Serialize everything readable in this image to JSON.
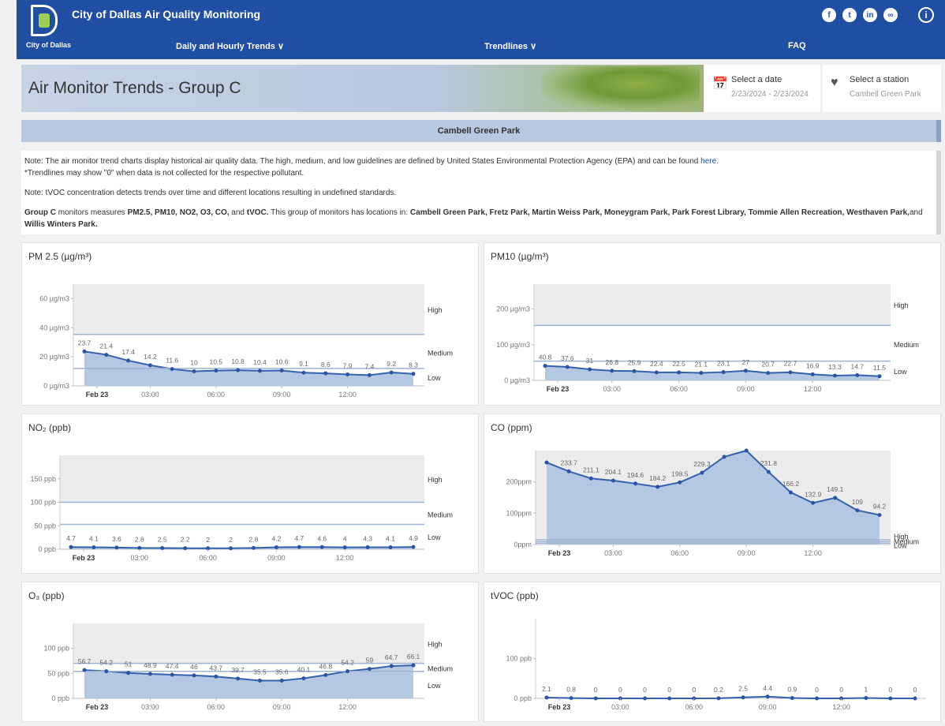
{
  "header": {
    "app_title": "City of Dallas Air Quality Monitoring",
    "logo_text": "City of Dallas",
    "nav": [
      "Daily and Hourly Trends ∨",
      "Trendlines ∨",
      "FAQ"
    ],
    "social": [
      "f",
      "t",
      "in",
      "∞"
    ],
    "info": "i"
  },
  "page_title": "Air Monitor Trends - Group C",
  "date_selector": {
    "label": "Select a date",
    "value": "2/23/2024 - 2/23/2024"
  },
  "station_selector": {
    "label": "Select a station",
    "value": "Cambell Green Park"
  },
  "station_name": "Cambell Green Park",
  "notes": {
    "line1": "Note: The air monitor trend charts display historical air quality data. The high, medium, and low guidelines are defined by United States Environmental Protection Agency (EPA) and can be found",
    "link": "here.",
    "line2": "*Trendlines may show \"0\" when data is not collected for the respective pollutant.",
    "line3": "Note: tVOC concentration detects trends over time and different locations resulting in undefined standards.",
    "group": "Group C",
    "measures_text": " monitors measures ",
    "pollutants": "PM2.5, PM10, NO2, O3, CO,",
    "and_text": " and ",
    "tvoc": "tVOC.",
    "locations_text": " This group of monitors has locations in: ",
    "locations": "Cambell Green Park, Fretz Park, Martin Weiss Park, Moneygram Park, Park Forest Library, Tommie Allen Recreation, Westhaven Park,",
    "and2": "and",
    "last_location": " Willis Winters Park."
  },
  "chart_data": [
    {
      "id": "pm25",
      "type": "area",
      "title": "PM 2.5 (µg/m³)",
      "x": [
        "00:30",
        "01:30",
        "02:30",
        "03:30",
        "04:30",
        "05:30",
        "06:30",
        "07:30",
        "08:30",
        "09:30",
        "10:30",
        "11:30",
        "12:30",
        "13:30",
        "14:30",
        "15:30"
      ],
      "x_ticks": [
        "Feb 23",
        "03:00",
        "06:00",
        "09:00",
        "12:00"
      ],
      "values": [
        23.7,
        21.4,
        17.4,
        14.2,
        11.6,
        10,
        10.5,
        10.8,
        10.4,
        10.6,
        9.1,
        8.6,
        7.9,
        7.4,
        9.2,
        8.3
      ],
      "ylim": [
        0,
        70
      ],
      "y_ticks": [
        0,
        20,
        40,
        60
      ],
      "y_tick_labels": [
        "0 µg/m3",
        "20 µg/m3",
        "40 µg/m3",
        "60 µg/m3"
      ],
      "thresholds": [
        {
          "name": "Low",
          "value": 12
        },
        {
          "name": "Medium",
          "value": 35.4
        }
      ],
      "band_labels": [
        "High",
        "Medium",
        "Low"
      ]
    },
    {
      "id": "pm10",
      "type": "area",
      "title": "PM10 (µg/m³)",
      "x": [
        "00:30",
        "01:30",
        "02:30",
        "03:30",
        "04:30",
        "05:30",
        "06:30",
        "07:30",
        "08:30",
        "09:30",
        "10:30",
        "11:30",
        "12:30",
        "13:30",
        "14:30",
        "15:30"
      ],
      "x_ticks": [
        "Feb 23",
        "03:00",
        "06:00",
        "09:00",
        "12:00"
      ],
      "values": [
        40.8,
        37.6,
        31,
        26.8,
        25.9,
        22.4,
        22.5,
        21.1,
        23.1,
        27,
        20.7,
        22.7,
        16.9,
        13.3,
        14.7,
        11.5
      ],
      "ylim": [
        0,
        270
      ],
      "y_ticks": [
        0,
        100,
        200
      ],
      "y_tick_labels": [
        "0 µg/m3",
        "100 µg/m3",
        "200 µg/m3"
      ],
      "thresholds": [
        {
          "name": "Low",
          "value": 54
        },
        {
          "name": "Medium",
          "value": 154
        }
      ],
      "band_labels": [
        "High",
        "Medium",
        "Low"
      ]
    },
    {
      "id": "no2",
      "type": "area",
      "title": "NO₂ (ppb)",
      "x": [
        "00:30",
        "01:30",
        "02:30",
        "03:30",
        "04:30",
        "05:30",
        "06:30",
        "07:30",
        "08:30",
        "09:30",
        "10:30",
        "11:30",
        "12:30",
        "13:30",
        "14:30",
        "15:30"
      ],
      "x_ticks": [
        "Feb 23",
        "03:00",
        "06:00",
        "09:00",
        "12:00"
      ],
      "values": [
        4.7,
        4.1,
        3.6,
        2.8,
        2.5,
        2.2,
        2,
        2,
        2.8,
        4.2,
        4.7,
        4.6,
        4,
        4.3,
        4.1,
        4.9
      ],
      "ylim": [
        0,
        200
      ],
      "y_ticks": [
        0,
        50,
        100,
        150
      ],
      "y_tick_labels": [
        "0 ppb",
        "50 ppb",
        "100 ppb",
        "150 ppb"
      ],
      "thresholds": [
        {
          "name": "Low",
          "value": 53
        },
        {
          "name": "Medium",
          "value": 100
        }
      ],
      "band_labels": [
        "High",
        "Medium",
        "Low"
      ]
    },
    {
      "id": "co",
      "type": "area",
      "title": "CO (ppm)",
      "x": [
        "00:30",
        "01:30",
        "02:30",
        "03:30",
        "04:30",
        "05:30",
        "06:30",
        "07:30",
        "08:30",
        "09:30",
        "10:30",
        "11:30",
        "12:30",
        "13:30",
        "14:30"
      ],
      "x_ticks": [
        "Feb 23",
        "03:00",
        "06:00",
        "09:00",
        "12:00"
      ],
      "values": [
        262,
        233.7,
        211.1,
        204.1,
        194.6,
        184.2,
        198.5,
        229.3,
        280,
        300,
        231.8,
        166.2,
        132.9,
        149.1,
        109,
        94.2
      ],
      "labels": [
        "",
        "233.7",
        "211.1",
        "204.1",
        "194.6",
        "184.2",
        "198.5",
        "229.3",
        "",
        "",
        "231.8",
        "166.2",
        "132.9",
        "149.1",
        "109",
        "94.2"
      ],
      "ylim": [
        0,
        300
      ],
      "y_ticks": [
        0,
        100,
        200
      ],
      "y_tick_labels": [
        "0ppm",
        "100ppm",
        "200ppm"
      ],
      "thresholds": [
        {
          "name": "Low",
          "value": 4.4
        },
        {
          "name": "Medium",
          "value": 9.4
        },
        {
          "name": "High",
          "value": 15
        }
      ],
      "band_labels": [
        "High",
        "Medium",
        "Low"
      ]
    },
    {
      "id": "o3",
      "type": "area",
      "title": "O₃ (ppb)",
      "x": [
        "00:30",
        "01:30",
        "02:30",
        "03:30",
        "04:30",
        "05:30",
        "06:30",
        "07:30",
        "08:30",
        "09:30",
        "10:30",
        "11:30",
        "12:30",
        "13:30",
        "14:30",
        "15:30"
      ],
      "x_ticks": [
        "Feb 23",
        "03:00",
        "06:00",
        "09:00",
        "12:00"
      ],
      "values": [
        56.7,
        54.2,
        51,
        48.9,
        47.4,
        46,
        43.7,
        39.7,
        35.5,
        35.6,
        40.1,
        46.8,
        54.2,
        59,
        64.7,
        66.1
      ],
      "ylim": [
        0,
        150
      ],
      "y_ticks": [
        0,
        50,
        100
      ],
      "y_tick_labels": [
        "0 ppb",
        "50 ppb",
        "100 ppb"
      ],
      "thresholds": [
        {
          "name": "Low",
          "value": 54
        },
        {
          "name": "Medium",
          "value": 70
        }
      ],
      "band_labels": [
        "High",
        "Medium",
        "Low"
      ]
    },
    {
      "id": "tvoc",
      "type": "line",
      "title": "tVOC (ppb)",
      "x": [
        "00:30",
        "01:30",
        "02:30",
        "03:30",
        "04:30",
        "05:30",
        "06:30",
        "07:30",
        "08:30",
        "09:30",
        "10:30",
        "11:30",
        "12:30",
        "13:30",
        "14:30",
        "15:30"
      ],
      "x_ticks": [
        "Feb 23",
        "03:00",
        "06:00",
        "09:00",
        "12:00"
      ],
      "values": [
        2.1,
        0.8,
        0,
        0,
        0,
        0,
        0,
        0.2,
        2.5,
        4.4,
        0.9,
        0,
        0,
        1,
        0,
        0
      ],
      "ylim": [
        0,
        200
      ],
      "y_ticks": [
        0,
        100
      ],
      "y_tick_labels": [
        "0 ppb",
        "100 ppb"
      ],
      "thresholds": [],
      "band_labels": []
    }
  ]
}
